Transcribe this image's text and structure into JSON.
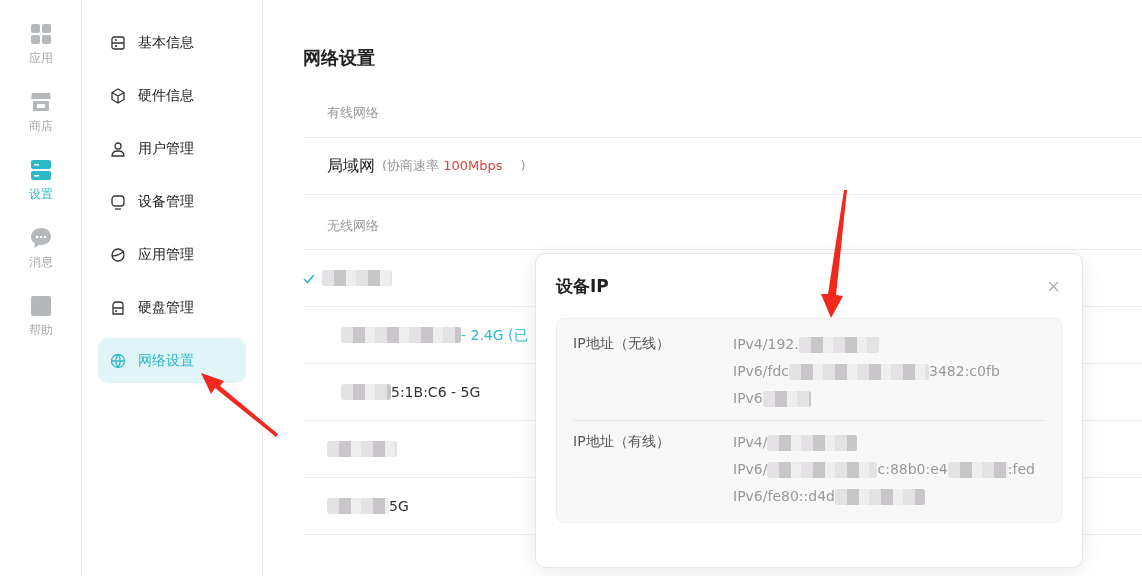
{
  "rail": [
    {
      "label": "应用",
      "selected": false
    },
    {
      "label": "商店",
      "selected": false
    },
    {
      "label": "设置",
      "selected": true
    },
    {
      "label": "消息",
      "selected": false
    },
    {
      "label": "帮助",
      "selected": false
    }
  ],
  "menu": [
    {
      "label": "基本信息",
      "selected": false
    },
    {
      "label": "硬件信息",
      "selected": false
    },
    {
      "label": "用户管理",
      "selected": false
    },
    {
      "label": "设备管理",
      "selected": false
    },
    {
      "label": "应用管理",
      "selected": false
    },
    {
      "label": "硬盘管理",
      "selected": false
    },
    {
      "label": "网络设置",
      "selected": true
    }
  ],
  "page_title": "网络设置",
  "wired": {
    "heading": "有线网络",
    "items": [
      {
        "name": "局域网",
        "note_prefix": "(协商速率",
        "speed": "100Mbps",
        "note_suffix": ")"
      }
    ]
  },
  "wireless": {
    "heading": "无线网络",
    "items": [
      {
        "checked": true,
        "highlighted": false,
        "parts": [
          {
            "kind": "blur"
          }
        ],
        "children": [
          {
            "checked": false,
            "highlighted": true,
            "parts": [
              {
                "kind": "blur"
              },
              {
                "kind": "text",
                "text": "- 2.4G (已"
              }
            ]
          },
          {
            "checked": false,
            "highlighted": false,
            "parts": [
              {
                "kind": "blur"
              },
              {
                "kind": "text",
                "text": "5:1B:C6 - 5G"
              }
            ]
          }
        ]
      },
      {
        "checked": false,
        "highlighted": false,
        "parts": [
          {
            "kind": "blur"
          }
        ]
      },
      {
        "checked": false,
        "highlighted": false,
        "parts": [
          {
            "kind": "blur"
          },
          {
            "kind": "text",
            "text": "5G"
          }
        ]
      }
    ]
  },
  "dialog": {
    "title": "设备IP",
    "sections": [
      {
        "label": "IP地址（无线）",
        "addresses": [
          {
            "parts": [
              {
                "kind": "text",
                "text": "IPv4/192."
              },
              {
                "kind": "blur"
              }
            ]
          },
          {
            "parts": [
              {
                "kind": "text",
                "text": "IPv6/fdc"
              },
              {
                "kind": "blur"
              },
              {
                "kind": "text",
                "text": "3482:c0fb"
              }
            ]
          },
          {
            "parts": [
              {
                "kind": "text",
                "text": "IPv6"
              },
              {
                "kind": "blur"
              }
            ]
          }
        ]
      },
      {
        "label": "IP地址（有线）",
        "addresses": [
          {
            "parts": [
              {
                "kind": "text",
                "text": "IPv4/"
              },
              {
                "kind": "blur"
              }
            ]
          },
          {
            "parts": [
              {
                "kind": "text",
                "text": "IPv6/"
              },
              {
                "kind": "blur"
              },
              {
                "kind": "text",
                "text": "c:88b0:e4"
              },
              {
                "kind": "blur"
              },
              {
                "kind": "text",
                "text": ":fed"
              }
            ]
          },
          {
            "parts": [
              {
                "kind": "text",
                "text": "IPv6/fe80::d4d"
              },
              {
                "kind": "blur"
              }
            ]
          }
        ]
      }
    ]
  }
}
